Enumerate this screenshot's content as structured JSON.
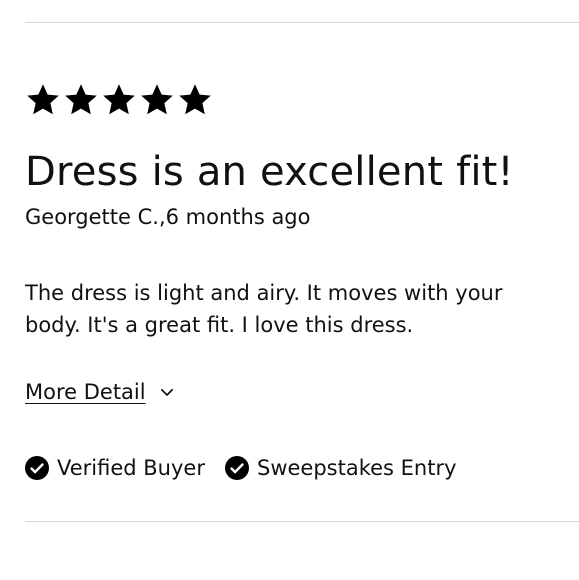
{
  "review": {
    "rating": 5,
    "rating_max": 5,
    "title": "Dress is an excellent fit!",
    "author_line": "Georgette C.,6 months ago",
    "body": "The dress is light and airy. It moves with your body. It's a great fit. I love this dress.",
    "more_detail_label": "More Detail",
    "badges": [
      {
        "icon": "check-circle-icon",
        "label": "Verified Buyer"
      },
      {
        "icon": "check-circle-icon",
        "label": "Sweepstakes Entry"
      }
    ]
  },
  "colors": {
    "text": "#111111",
    "divider": "#d6d6d6",
    "star": "#000000"
  }
}
